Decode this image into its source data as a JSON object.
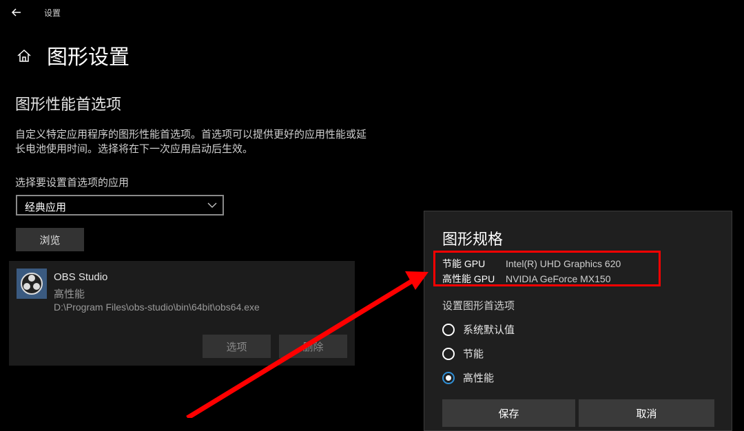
{
  "window": {
    "title": "设置"
  },
  "icons": {
    "back": "back-arrow-icon",
    "home": "home-icon",
    "chevron": "chevron-down-icon",
    "app": "obs-logo-icon"
  },
  "page": {
    "title": "图形设置",
    "section_title": "图形性能首选项",
    "description": "自定义特定应用程序的图形性能首选项。首选项可以提供更好的应用性能或延长电池使用时间。选择将在下一次应用启动后生效。",
    "select_label": "选择要设置首选项的应用",
    "dropdown_value": "经典应用",
    "browse_label": "浏览"
  },
  "app_item": {
    "name": "OBS Studio",
    "preference": "高性能",
    "path": "D:\\Program Files\\obs-studio\\bin\\64bit\\obs64.exe",
    "options_label": "选项",
    "delete_label": "删除"
  },
  "dialog": {
    "title": "图形规格",
    "gpus": [
      {
        "label": "节能 GPU",
        "value": "Intel(R) UHD Graphics 620"
      },
      {
        "label": "高性能 GPU",
        "value": "NVIDIA GeForce MX150"
      }
    ],
    "set_label": "设置图形首选项",
    "options": [
      {
        "label": "系统默认值",
        "selected": false
      },
      {
        "label": "节能",
        "selected": false
      },
      {
        "label": "高性能",
        "selected": true
      }
    ],
    "save_label": "保存",
    "cancel_label": "取消"
  },
  "colors": {
    "background": "#000000",
    "accent": "#2f8fd6",
    "highlight": "#ff0000"
  }
}
